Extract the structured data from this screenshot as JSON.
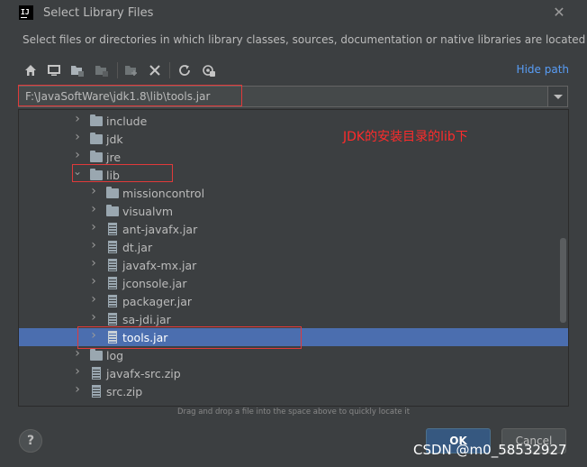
{
  "window": {
    "app_logo_text": "IJ",
    "title": "Select Library Files",
    "close_icon": "close-icon"
  },
  "description": "Select files or directories in which library classes, sources, documentation or native libraries are located",
  "toolbar": {
    "icons": [
      "home-icon",
      "desktop-icon",
      "project-folder-icon",
      "module-folder-icon",
      "new-folder-icon",
      "delete-icon",
      "refresh-icon",
      "show-hidden-icon"
    ],
    "hide_path_label": "Hide path"
  },
  "path": {
    "value": "F:\\JavaSoftWare\\jdk1.8\\lib\\tools.jar"
  },
  "tree": {
    "rows": [
      {
        "label": "include",
        "type": "folder",
        "level": 0,
        "expanded": false,
        "selected": false
      },
      {
        "label": "jdk",
        "type": "folder",
        "level": 0,
        "expanded": false,
        "selected": false
      },
      {
        "label": "jre",
        "type": "folder",
        "level": 0,
        "expanded": false,
        "selected": false
      },
      {
        "label": "lib",
        "type": "folder",
        "level": 0,
        "expanded": true,
        "selected": false
      },
      {
        "label": "missioncontrol",
        "type": "folder",
        "level": 1,
        "expanded": false,
        "selected": false
      },
      {
        "label": "visualvm",
        "type": "folder",
        "level": 1,
        "expanded": false,
        "selected": false
      },
      {
        "label": "ant-javafx.jar",
        "type": "jar",
        "level": 1,
        "expanded": false,
        "selected": false
      },
      {
        "label": "dt.jar",
        "type": "jar",
        "level": 1,
        "expanded": false,
        "selected": false
      },
      {
        "label": "javafx-mx.jar",
        "type": "jar",
        "level": 1,
        "expanded": false,
        "selected": false
      },
      {
        "label": "jconsole.jar",
        "type": "jar",
        "level": 1,
        "expanded": false,
        "selected": false
      },
      {
        "label": "packager.jar",
        "type": "jar",
        "level": 1,
        "expanded": false,
        "selected": false
      },
      {
        "label": "sa-jdi.jar",
        "type": "jar",
        "level": 1,
        "expanded": false,
        "selected": false
      },
      {
        "label": "tools.jar",
        "type": "jar",
        "level": 1,
        "expanded": false,
        "selected": true
      },
      {
        "label": "log",
        "type": "folder",
        "level": 0,
        "expanded": false,
        "selected": false
      },
      {
        "label": "javafx-src.zip",
        "type": "jar",
        "level": 0,
        "expanded": false,
        "selected": false
      },
      {
        "label": "src.zip",
        "type": "jar",
        "level": 0,
        "expanded": false,
        "selected": false
      }
    ]
  },
  "annotation": {
    "text": "JDK的安装目录的lib下",
    "color": "#ff2b2b"
  },
  "hint": "Drag and drop a file into the space above to quickly locate it",
  "buttons": {
    "help": "?",
    "ok": "OK",
    "cancel": "Cancel"
  },
  "watermark": "CSDN @m0_58532927",
  "colors": {
    "background": "#3c3f41",
    "selection": "#4b6eaf",
    "link": "#589df6",
    "ok_button": "#365880"
  }
}
